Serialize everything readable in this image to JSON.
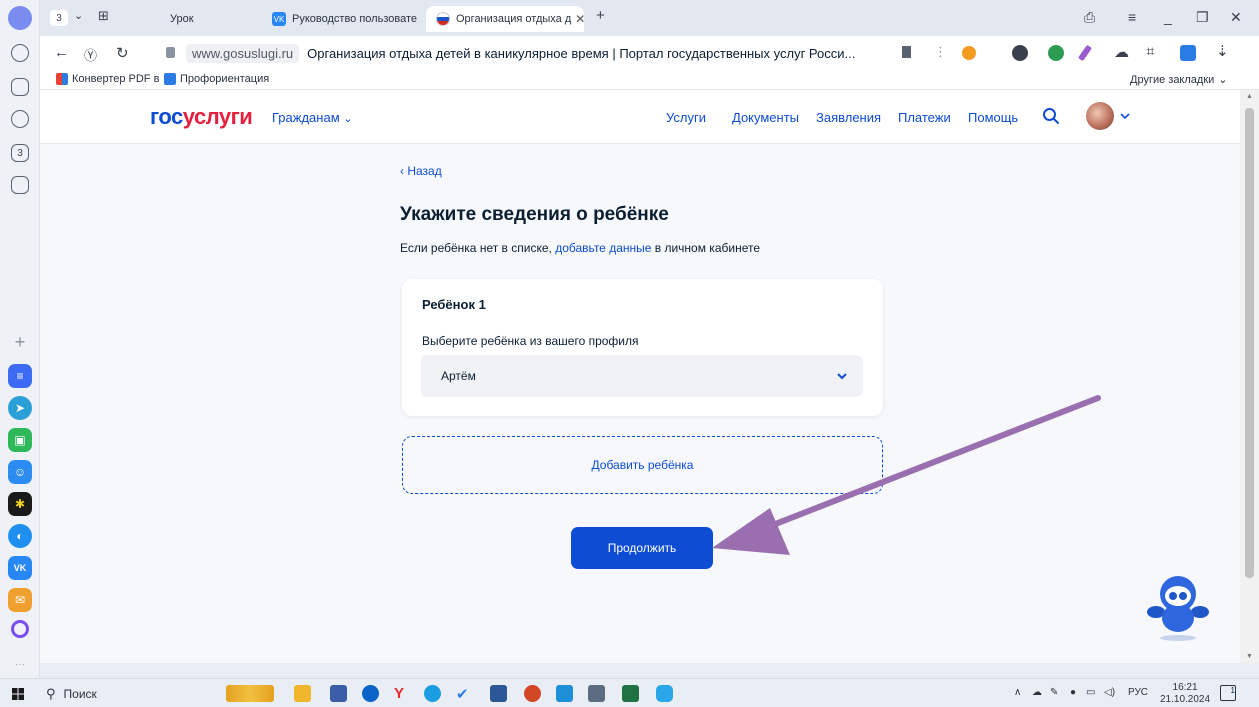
{
  "browser": {
    "tab_count": "3",
    "tabs": [
      {
        "label": "Урок"
      },
      {
        "label": "Руководство пользовате"
      },
      {
        "label": "Организация отдыха д"
      }
    ],
    "tab_vk_badge": "VK",
    "url_domain": "www.gosuslugi.ru",
    "page_title": "Организация отдыха детей в каникулярное время | Портал государственных услуг Росси...",
    "bookmarks": [
      {
        "label": "Конвертер PDF в"
      },
      {
        "label": "Профориентация"
      }
    ],
    "other_bookmarks": "Другие закладки",
    "sidebar_counter": "3"
  },
  "site": {
    "logo_part1": "гос",
    "logo_part2": "услуги",
    "citizens_menu": "Гражданам",
    "nav": [
      "Услуги",
      "Документы",
      "Заявления",
      "Платежи",
      "Помощь"
    ]
  },
  "form": {
    "back": "Назад",
    "title": "Укажите сведения о ребёнке",
    "sub_before": "Если ребёнка нет в списке, ",
    "sub_link": "добавьте данные",
    "sub_after": " в личном кабинете",
    "card_title": "Ребёнок 1",
    "select_label": "Выберите ребёнка из вашего профиля",
    "select_value": "Артём",
    "add_child": "Добавить ребёнка",
    "continue": "Продолжить"
  },
  "taskbar": {
    "search": "Поиск",
    "lang": "РУС",
    "time": "16:21",
    "date": "21.10.2024",
    "notif_count": "1"
  },
  "colors": {
    "primary": "#0d4cd3",
    "logo_red": "#e3213f",
    "annotation_arrow": "#9a6fb0"
  }
}
